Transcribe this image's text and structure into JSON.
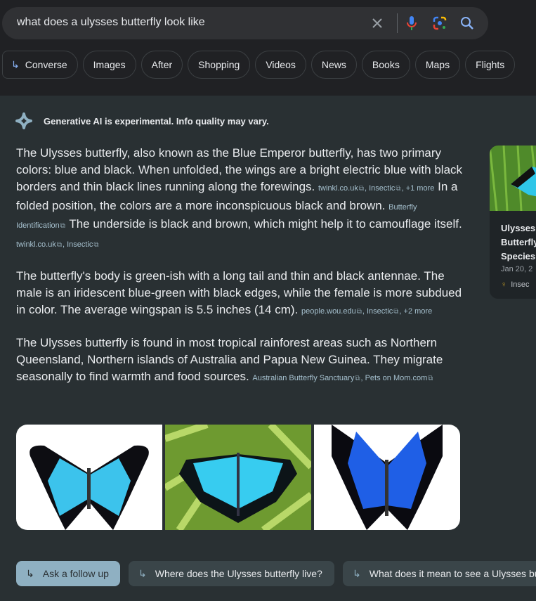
{
  "search": {
    "query": "what does a ulysses butterfly look like"
  },
  "chips": [
    "Converse",
    "Images",
    "After",
    "Shopping",
    "Videos",
    "News",
    "Books",
    "Maps",
    "Flights"
  ],
  "ai": {
    "notice": "Generative AI is experimental. Info quality may vary.",
    "p1": {
      "t1": "The Ulysses butterfly, also known as the Blue Emperor butterfly, has two primary colors: blue and black. When unfolded, the wings are a bright electric blue with black borders and thin black lines running along the forewings.",
      "c1": "twinkl.co.uk",
      "c2": "Insectic",
      "c3": "+1 more",
      "t2": "In a folded position, the colors are a more inconspicuous black and brown.",
      "c4": "Butterfly Identification",
      "t3": "The underside is black and brown, which might help it to camouflage itself.",
      "c5": "twinkl.co.uk",
      "c6": "Insectic"
    },
    "p2": {
      "t1": "The butterfly's body is green-ish with a long tail and thin and black antennae. The male is an iridescent blue-green with black edges, while the female is more subdued in color. The average wingspan is 5.5 inches (14 cm).",
      "c1": "people.wou.edu",
      "c2": "Insectic",
      "c3": "+2 more"
    },
    "p3": {
      "t1": "The Ulysses butterfly is found in most tropical rainforest areas such as Northern Queensland, Northern islands of Australia and Papua New Guinea. They migrate seasonally to find warmth and food sources.",
      "c1": "Australian Butterfly Sanctuary",
      "c2": "Pets on Mom.com"
    },
    "card": {
      "title": "Ulysses Butterfly Species",
      "date": "Jan 20, 2",
      "source": "Insec"
    },
    "followups": [
      "Ask a follow up",
      "Where does the Ulysses butterfly live?",
      "What does it mean to see a Ulysses bu"
    ]
  },
  "colors": {
    "accent": "#8ab4f8",
    "ai_bg": "#293033",
    "citation": "#a6c1cf"
  }
}
